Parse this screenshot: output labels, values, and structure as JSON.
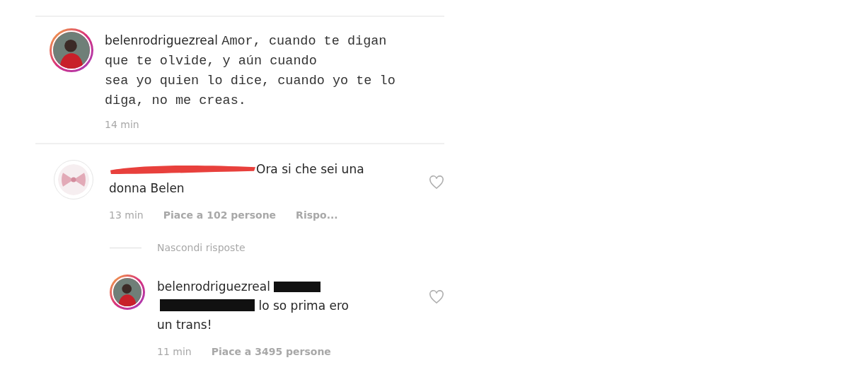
{
  "caption": {
    "username": "belenrodriguezreal",
    "text": "Amor, cuando te digan que te olvide, y aún cuando\nsea yo quien lo dice, cuando yo te lo diga, no me creas.",
    "time": "14 min",
    "avatar": {
      "kind": "person",
      "story_ring": true
    }
  },
  "comments": [
    {
      "avatar": {
        "kind": "bow",
        "story_ring": false
      },
      "username_redacted": true,
      "text": "Ora si che sei una donna Belen",
      "time": "13 min",
      "likes": "Piace a 102 persone",
      "reply": "Rispo...",
      "replies_toggle": "Nascondi risposte",
      "replies": [
        {
          "avatar": {
            "kind": "person",
            "story_ring": true
          },
          "username": "belenrodriguezreal",
          "mention_redacted": true,
          "text": "lo so prima ero un trans!",
          "time": "11 min",
          "likes": "Piace a 3495 persone"
        }
      ]
    }
  ]
}
